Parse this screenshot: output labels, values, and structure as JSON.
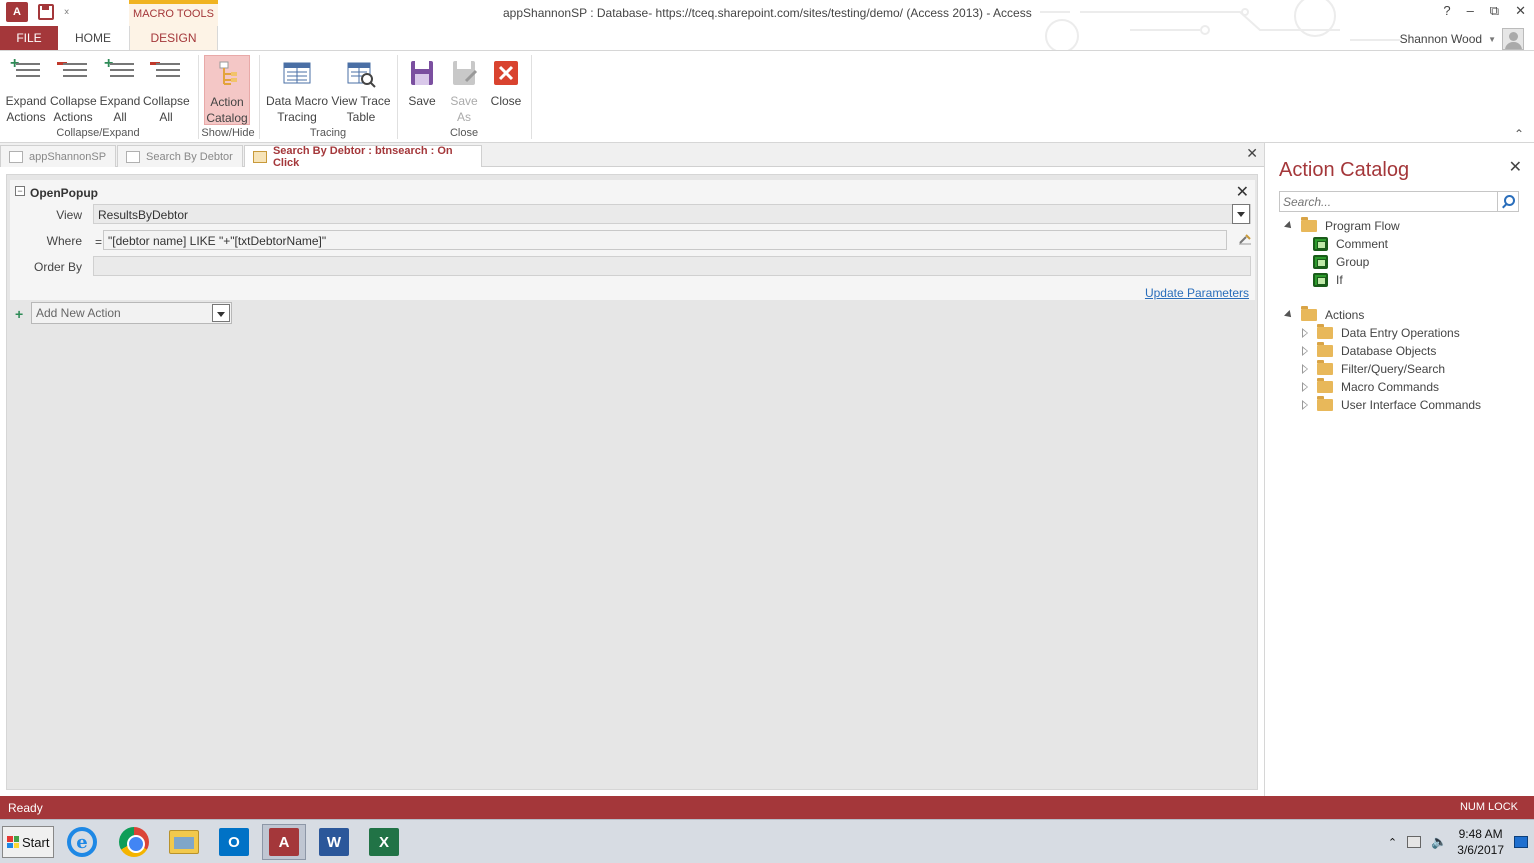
{
  "window": {
    "title": "appShannonSP : Database- https://tceq.sharepoint.com/sites/testing/demo/ (Access 2013) - Access",
    "contextual_tab_group": "MACRO TOOLS",
    "user_name": "Shannon Wood",
    "app_icon_text": "A",
    "controls": {
      "help": "?",
      "minimize": "–",
      "restore": "⧉",
      "close": "✕"
    }
  },
  "ribbon": {
    "tabs": [
      {
        "label": "FILE"
      },
      {
        "label": "HOME"
      },
      {
        "label": "DESIGN",
        "active": true
      }
    ],
    "buttons": {
      "expand_actions": "Expand Actions",
      "collapse_actions": "Collapse Actions",
      "expand_all": "Expand All",
      "collapse_all": "Collapse All",
      "action_catalog": "Action Catalog",
      "data_macro_tracing": "Data Macro Tracing",
      "view_trace_table": "View Trace Table",
      "save": "Save",
      "save_as": "Save As",
      "close": "Close"
    },
    "groups": {
      "collapse_expand": "Collapse/Expand",
      "show_hide": "Show/Hide",
      "tracing": "Tracing",
      "close": "Close"
    }
  },
  "document_tabs": [
    {
      "label": "appShannonSP",
      "active": false
    },
    {
      "label": "Search By Debtor",
      "active": false
    },
    {
      "label": "Search By Debtor : btnsearch : On Click",
      "active": true
    }
  ],
  "macro": {
    "action_name": "OpenPopup",
    "arguments": {
      "view_label": "View",
      "view_value": "ResultsByDebtor",
      "where_label": "Where",
      "where_eq": "=",
      "where_value": "\"[debtor name] LIKE \"+\"[txtDebtorName]\"",
      "order_by_label": "Order By",
      "order_by_value": ""
    },
    "update_parameters": "Update Parameters",
    "add_new_action": "Add New Action"
  },
  "catalog": {
    "title": "Action Catalog",
    "search_placeholder": "Search...",
    "program_flow": {
      "label": "Program Flow",
      "items": [
        "Comment",
        "Group",
        "If"
      ]
    },
    "actions": {
      "label": "Actions",
      "items": [
        "Data Entry Operations",
        "Database Objects",
        "Filter/Query/Search",
        "Macro Commands",
        "User Interface Commands"
      ]
    }
  },
  "status": {
    "left": "Ready",
    "right": "NUM LOCK"
  },
  "taskbar": {
    "start": "Start",
    "apps": [
      "internet-explorer",
      "chrome",
      "file-explorer",
      "outlook",
      "access",
      "word",
      "excel"
    ],
    "app_letters": {
      "outlook": "O",
      "access": "A",
      "word": "W",
      "excel": "X"
    },
    "time": "9:48 AM",
    "date": "3/6/2017"
  },
  "colors": {
    "access_red": "#a4373a",
    "macro_tools_accent": "#f0b321",
    "link_blue": "#2a6ebb"
  }
}
